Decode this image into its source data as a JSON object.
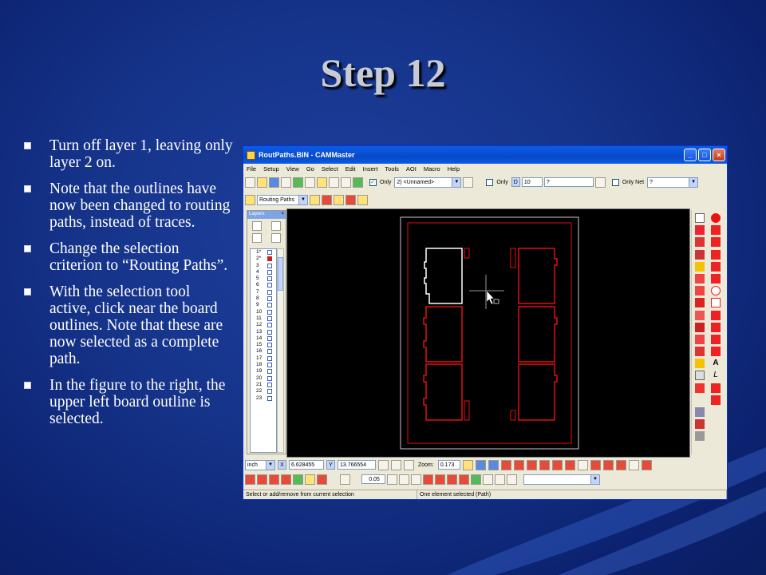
{
  "slide": {
    "title": "Step 12",
    "bullets": [
      "Turn off layer 1, leaving only layer 2 on.",
      "Note that the outlines have now been changed to routing paths, instead of traces.",
      "Change the selection criterion to “Routing Paths”.",
      "With the selection tool active, click near the board outlines.  Note that these are now selected as a complete path.",
      "In the figure to the right, the upper left board outline is selected."
    ]
  },
  "window": {
    "title": "RoutPaths.BIN - CAMMaster",
    "controls": {
      "minimize": "_",
      "maximize": "□",
      "close": "×"
    },
    "menu": [
      "File",
      "Setup",
      "View",
      "Go",
      "Select",
      "Edit",
      "Insert",
      "Tools",
      "AOI",
      "Macro",
      "Help"
    ],
    "toolbar1": {
      "only_label": "Only",
      "only_checked": true,
      "layer_combo": "2) <Unnamed>",
      "only2_label": "Only",
      "d_label": "D",
      "d_value": "10",
      "q_value": "?",
      "only_net_label": "Only Net",
      "net_value": "?"
    },
    "toolbar2": {
      "selection_criterion": "Routing Paths"
    },
    "layers": {
      "header": "Layers",
      "close": "×",
      "rows": [
        "1*",
        "2*",
        "3",
        "4",
        "5",
        "6",
        "7",
        "8",
        "9",
        "10",
        "11",
        "12",
        "13",
        "14",
        "15",
        "16",
        "17",
        "18",
        "19",
        "20",
        "21",
        "22",
        "23"
      ]
    },
    "coordbar": {
      "unit": "inch",
      "x_label": "X",
      "x_value": "6.628455",
      "y_label": "Y",
      "y_value": "13.766554",
      "zoom_label": "Zoom:",
      "zoom_value": "0.173"
    },
    "bottombar": {
      "grid_value": "0.05"
    },
    "status": {
      "left": "Select or add/remove from current selection",
      "right": "One element selected (Path)"
    },
    "colors": {
      "trace_red": "#e01010",
      "selected_white": "#ffffff",
      "panel_outline": "#c8c8c8"
    }
  }
}
